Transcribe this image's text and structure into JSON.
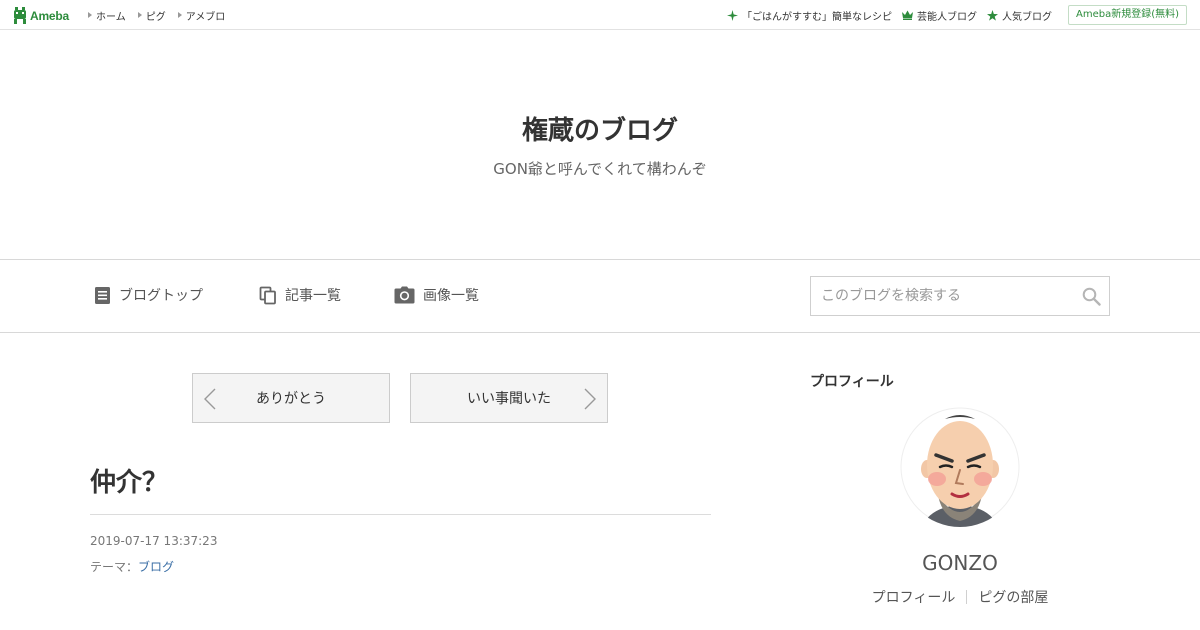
{
  "header": {
    "logo_text": "Ameba",
    "nav": [
      "ホーム",
      "ピグ",
      "アメブロ"
    ],
    "right_links": [
      {
        "label": "「ごはんがすすむ」簡単なレシピ",
        "icon": "sparkle-icon"
      },
      {
        "label": "芸能人ブログ",
        "icon": "crown-icon"
      },
      {
        "label": "人気ブログ",
        "icon": "star-icon"
      }
    ],
    "signup_label": "Ameba新規登録(無料)",
    "accent_color": "#2d8c3c"
  },
  "blog": {
    "title": "権蔵のブログ",
    "description": "GON爺と呼んでくれて構わんぞ"
  },
  "blog_nav": {
    "items": [
      {
        "label": "ブログトップ",
        "icon": "document-icon"
      },
      {
        "label": "記事一覧",
        "icon": "copy-icon"
      },
      {
        "label": "画像一覧",
        "icon": "camera-icon"
      }
    ],
    "search_placeholder": "このブログを検索する"
  },
  "pager": {
    "prev_label": "ありがとう",
    "next_label": "いい事聞いた"
  },
  "article": {
    "title": "仲介？",
    "date": "2019-07-17 13:37:23",
    "theme_label": "テーマ：",
    "theme_value": "ブログ"
  },
  "sidebar": {
    "heading": "プロフィール",
    "name": "GONZO",
    "links": [
      "プロフィール",
      "ピグの部屋"
    ]
  }
}
